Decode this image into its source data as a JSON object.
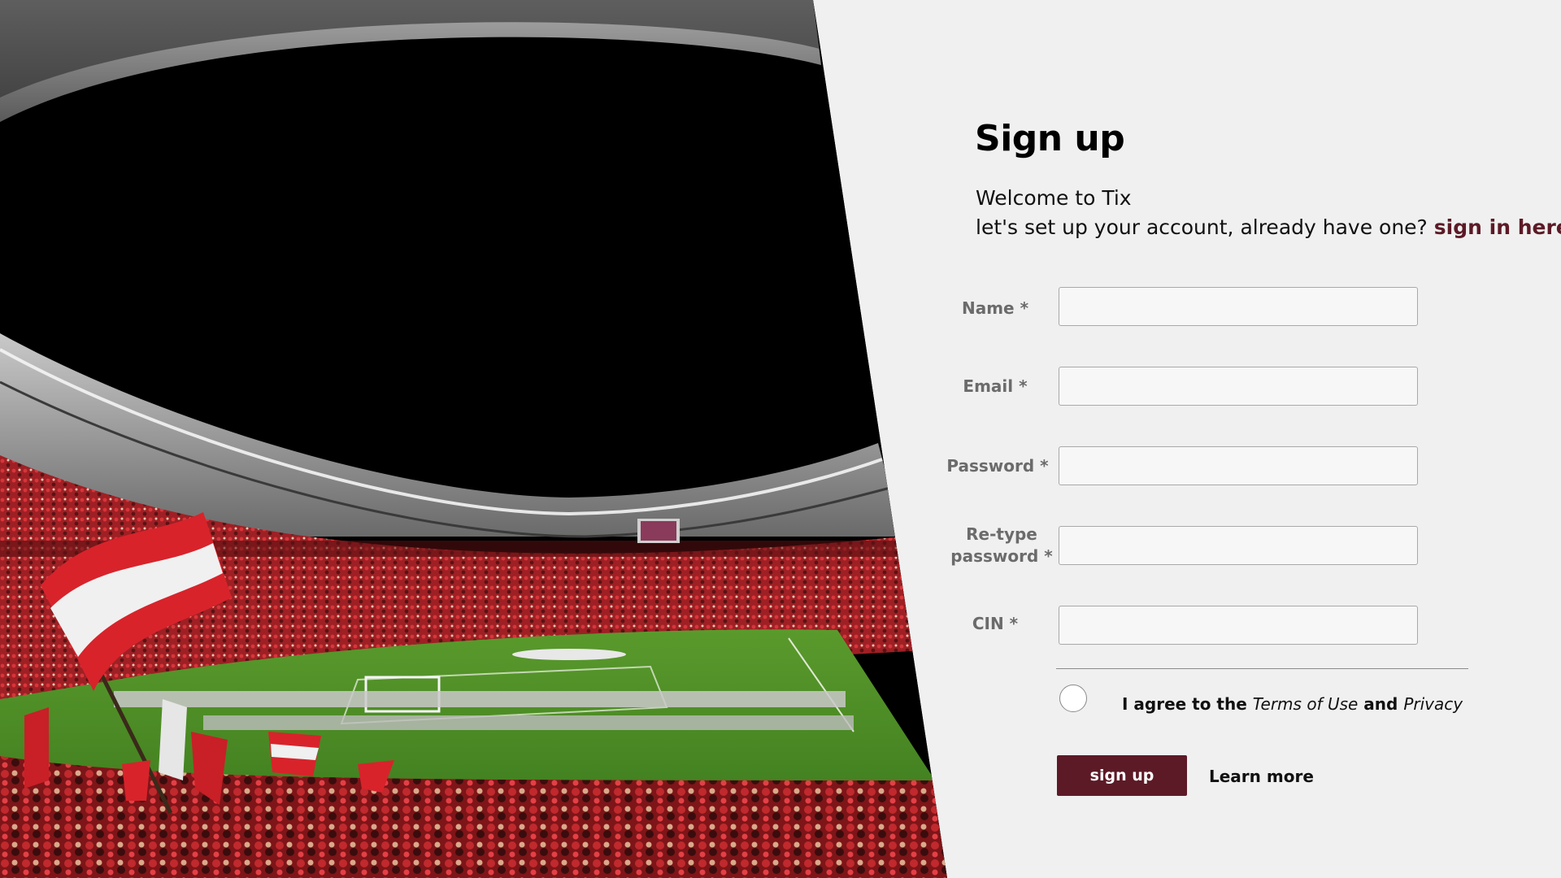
{
  "colors": {
    "accent": "#5c1a26",
    "background": "#f0f0f0",
    "input_bg": "#f7f7f7",
    "label_gray": "#6b6b6b"
  },
  "hero": {
    "image": "stadium-crowd-photo"
  },
  "form": {
    "title": "Sign up",
    "welcome_line1": "Welcome to Tix",
    "welcome_line2": "let's set up your account, already have one?",
    "signin_link": "sign in here.",
    "fields": [
      {
        "label": "Name *",
        "value": ""
      },
      {
        "label": "Email *",
        "value": ""
      },
      {
        "label": "Password *",
        "value": ""
      },
      {
        "label_line1": "Re-type",
        "label_line2": "password *",
        "value": ""
      },
      {
        "label": "CIN *",
        "value": ""
      }
    ],
    "agree": {
      "prefix": "I agree to the",
      "terms": "Terms of Use",
      "and": "and",
      "privacy": "Privacy",
      "checked": false
    },
    "signup_button": "sign up",
    "learn_more": "Learn more"
  }
}
